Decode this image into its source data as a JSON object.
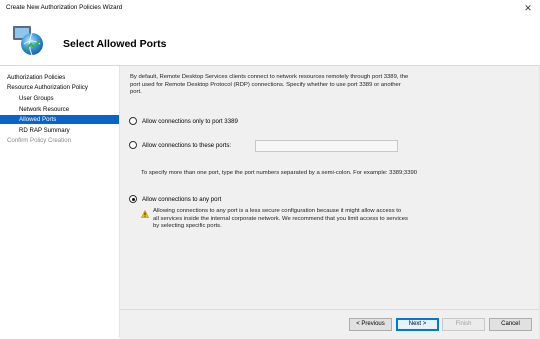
{
  "window": {
    "title": "Create New Authorization Policies Wizard",
    "close_glyph": "✕"
  },
  "header": {
    "title": "Select Allowed Ports",
    "icon": "network-globe-icon"
  },
  "nav": {
    "items": [
      {
        "label": "Authorization Policies",
        "level": "top",
        "state": "normal"
      },
      {
        "label": "Resource Authorization Policy",
        "level": "top",
        "state": "normal"
      },
      {
        "label": "User Groups",
        "level": "sub",
        "state": "normal"
      },
      {
        "label": "Network Resource",
        "level": "sub",
        "state": "normal"
      },
      {
        "label": "Allowed Ports",
        "level": "sub",
        "state": "active"
      },
      {
        "label": "RD RAP Summary",
        "level": "sub",
        "state": "normal"
      },
      {
        "label": "Confirm Policy Creation",
        "level": "top",
        "state": "disabled"
      }
    ]
  },
  "content": {
    "description": "By default, Remote Desktop Services clients connect to network resources remotely through port 3389, the port used for Remote Desktop Protocol (RDP) connections. Specify whether to use port 3389 or another port.",
    "option_3389": "Allow connections only to port 3389",
    "option_these_ports": "Allow connections to these ports:",
    "ports_value": "",
    "hint": "To specify more than one port, type the port numbers separated by a semi-colon. For example: 3389;3390",
    "option_any_port": "Allow connections to any port",
    "selected_option": "any_port",
    "warning": "Allowing connections to any port is a less secure configuration because it might allow access to all services inside the internal corporate network. We recommend that you limit access to services by selecting specific ports."
  },
  "footer": {
    "previous": "< Previous",
    "next": "Next >",
    "finish": "Finish",
    "cancel": "Cancel"
  },
  "colors": {
    "accent": "#0a64c8",
    "warning": "#f2c200"
  }
}
